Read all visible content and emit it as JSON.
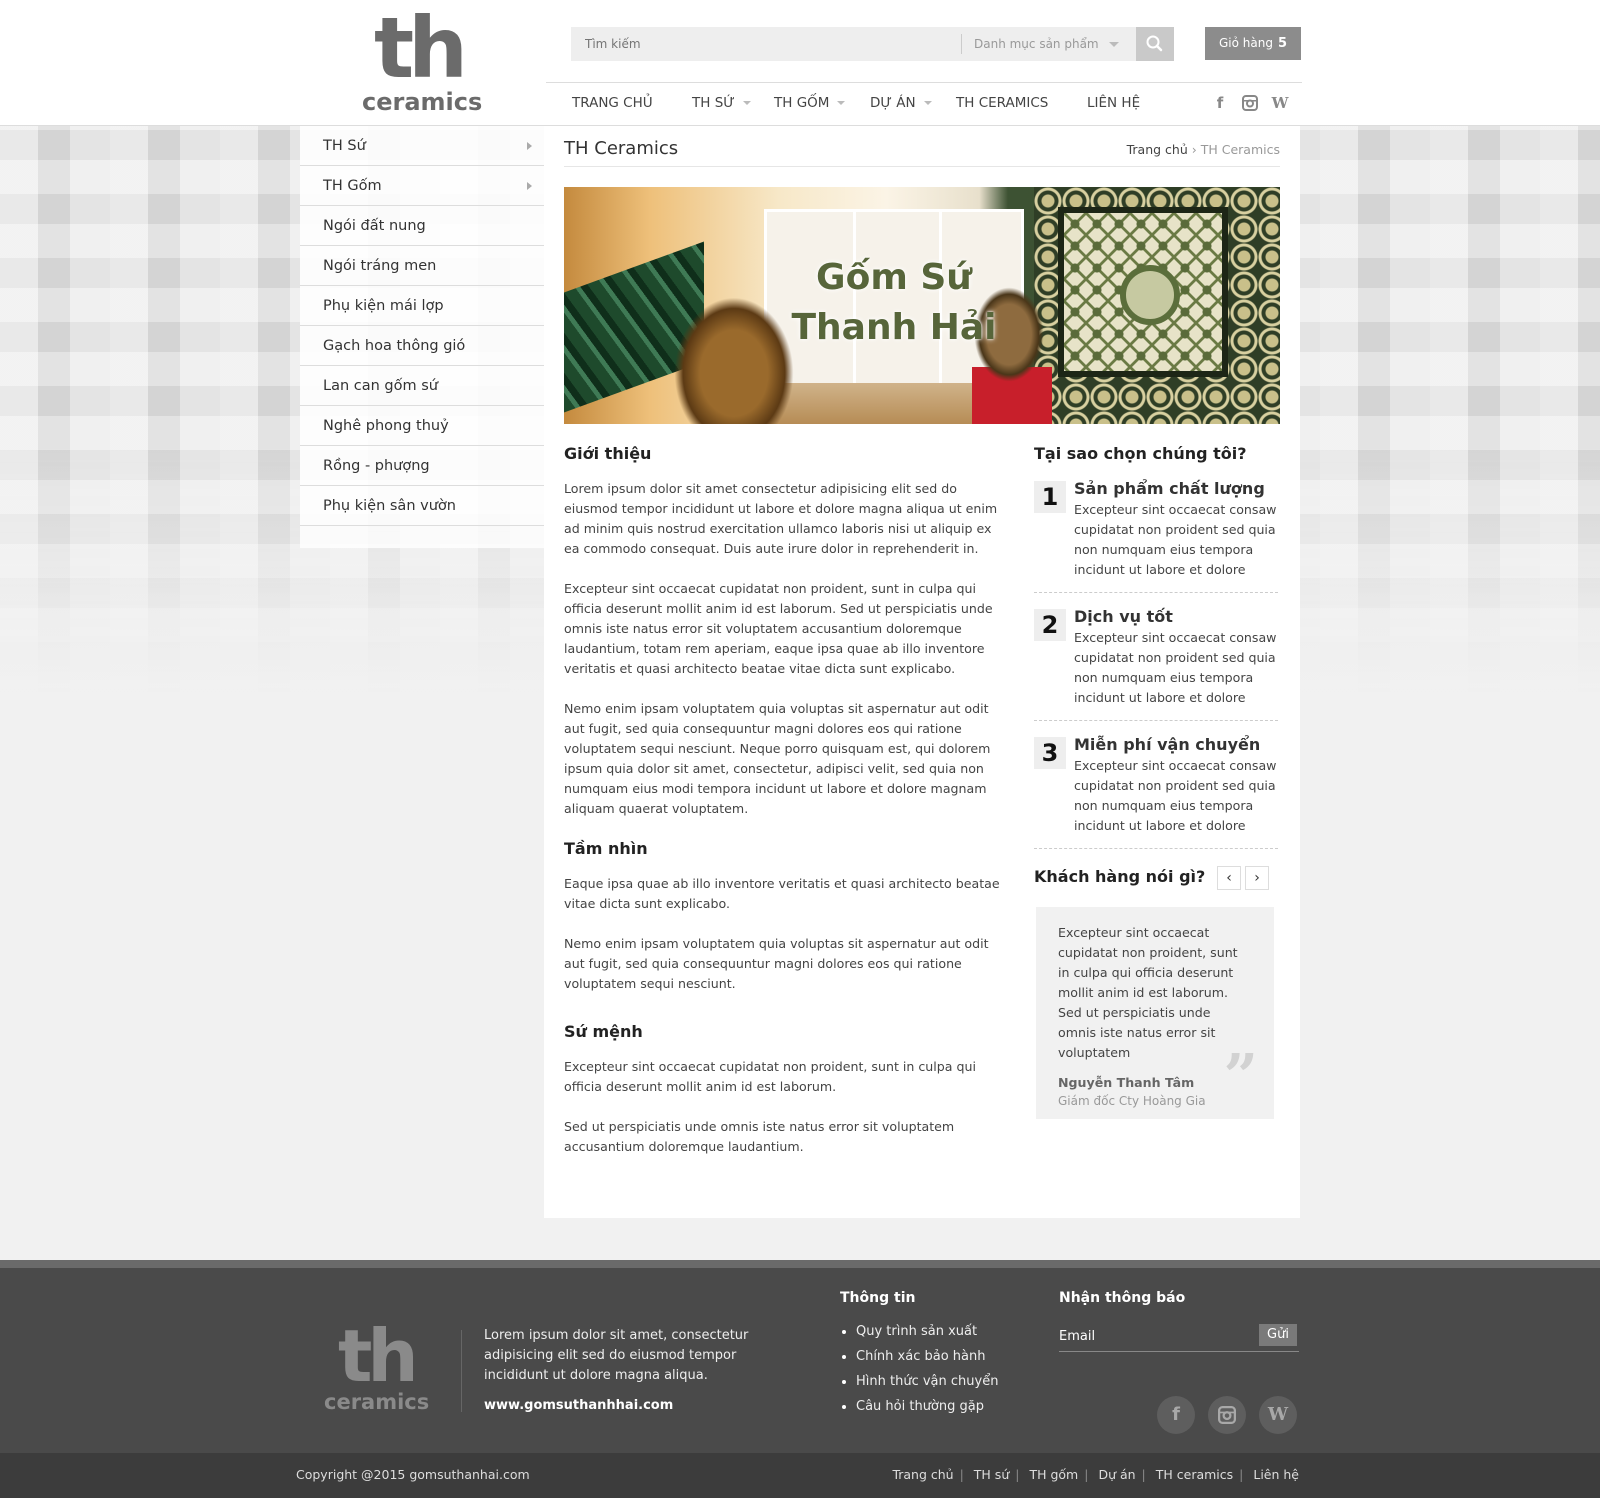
{
  "header": {
    "logo_main": "th",
    "logo_sub": "ceramics",
    "search_placeholder": "Tìm kiếm",
    "category_select": "Danh mục sản phẩm",
    "cart_label": "Giỏ hàng",
    "cart_count": "5"
  },
  "nav": {
    "items": [
      {
        "label": "TRANG CHỦ",
        "dropdown": false
      },
      {
        "label": "TH SỨ",
        "dropdown": true
      },
      {
        "label": "TH GỐM",
        "dropdown": true
      },
      {
        "label": "DỰ ÁN",
        "dropdown": true
      },
      {
        "label": "TH CERAMICS",
        "dropdown": false
      },
      {
        "label": "LIÊN HỆ",
        "dropdown": false
      }
    ],
    "social": [
      "facebook-icon",
      "instagram-icon",
      "wordpress-icon"
    ]
  },
  "sidebar": {
    "items": [
      {
        "label": "TH Sứ",
        "arrow": true
      },
      {
        "label": "TH Gốm",
        "arrow": true
      },
      {
        "label": "Ngói đất nung",
        "arrow": false
      },
      {
        "label": "Ngói tráng men",
        "arrow": false
      },
      {
        "label": "Phụ kiện mái lợp",
        "arrow": false
      },
      {
        "label": "Gạch hoa thông gió",
        "arrow": false
      },
      {
        "label": "Lan can gốm sứ",
        "arrow": false
      },
      {
        "label": "Nghê phong thuỷ",
        "arrow": false
      },
      {
        "label": "Rồng - phượng",
        "arrow": false
      },
      {
        "label": "Phụ kiện sân vườn",
        "arrow": false
      }
    ]
  },
  "page": {
    "title": "TH Ceramics",
    "breadcrumb": {
      "home": "Trang chủ",
      "sep": "›",
      "current": "TH Ceramics"
    },
    "banner": {
      "line1": "Gốm Sứ",
      "line2": "Thanh Hải"
    }
  },
  "content": {
    "intro_title": "Giới thiệu",
    "intro_p1": "Lorem ipsum dolor sit amet consectetur adipisicing elit sed do eiusmod tempor incididunt ut labore et dolore magna aliqua ut enim ad minim quis nostrud exercitation ullamco laboris nisi ut aliquip ex ea commodo consequat. Duis aute irure dolor in reprehenderit in.",
    "intro_p2": "Excepteur sint occaecat cupidatat non proident, sunt in culpa qui officia deserunt mollit anim id est laborum. Sed ut perspiciatis unde omnis iste natus error sit voluptatem accusantium doloremque laudantium, totam rem aperiam, eaque ipsa quae ab illo inventore veritatis et quasi architecto beatae vitae dicta sunt explicabo.",
    "intro_p3": "Nemo enim ipsam voluptatem quia voluptas sit aspernatur aut odit aut fugit, sed quia consequuntur magni dolores eos qui ratione voluptatem sequi nesciunt. Neque porro quisquam est, qui dolorem ipsum quia dolor sit amet, consectetur, adipisci velit, sed quia non numquam eius modi tempora incidunt ut labore et dolore magnam aliquam quaerat voluptatem.",
    "vision_title": "Tầm nhìn",
    "vision_p1": "Eaque ipsa quae ab illo inventore veritatis et quasi architecto beatae vitae dicta sunt explicabo.",
    "vision_p2": "Nemo enim ipsam voluptatem quia voluptas sit aspernatur aut odit aut fugit, sed quia consequuntur magni dolores eos qui ratione voluptatem sequi nesciunt.",
    "mission_title": "Sứ mệnh",
    "mission_p1": "Excepteur sint occaecat cupidatat non proident, sunt in culpa qui officia deserunt mollit anim id est laborum.",
    "mission_p2": "Sed ut perspiciatis unde omnis iste natus error sit voluptatem accusantium doloremque laudantium."
  },
  "why": {
    "title": "Tại sao chọn chúng tôi?",
    "items": [
      {
        "num": "1",
        "title": "Sản phẩm chất lượng",
        "desc": "Excepteur sint occaecat consaw cupidatat non proident  sed quia non numquam eius tempora incidunt ut labore et dolore"
      },
      {
        "num": "2",
        "title": "Dịch vụ tốt",
        "desc": "Excepteur sint occaecat consaw cupidatat non proident  sed quia non numquam eius tempora incidunt ut labore et dolore"
      },
      {
        "num": "3",
        "title": "Miễn phí vận chuyển",
        "desc": "Excepteur sint occaecat consaw cupidatat non proident  sed quia non numquam eius tempora incidunt ut labore et dolore"
      }
    ]
  },
  "testimonial": {
    "title": "Khách hàng nói gì?",
    "prev": "‹",
    "next": "›",
    "quote": "Excepteur sint occaecat cupidatat non proident, sunt in culpa qui officia deserunt mollit anim id est laborum. Sed ut perspiciatis unde omnis iste natus error sit voluptatem",
    "name": "Nguyễn Thanh Tâm",
    "role": "Giám đốc Cty Hoàng Gia"
  },
  "footer": {
    "logo_main": "th",
    "logo_sub": "ceramics",
    "about": "Lorem ipsum dolor sit amet, consectetur adipisicing elit sed do eiusmod tempor incididunt ut dolore magna aliqua.",
    "url": "www.gomsuthanhhai.com",
    "info_title": "Thông tin",
    "info_links": [
      "Quy trình sản xuất",
      "Chính xác bảo hành",
      "Hình thức vận chuyển",
      "Câu hỏi thường gặp"
    ],
    "news_title": "Nhận thông báo",
    "email_placeholder": "Email",
    "send_label": "Gửi",
    "social": [
      "facebook-icon",
      "instagram-icon",
      "wordpress-icon"
    ]
  },
  "bottom": {
    "copyright": "Copyright @2015 gomsuthanhai.com",
    "links": [
      "Trang chủ",
      "TH sứ",
      "TH gốm",
      "Dự án",
      "TH ceramics",
      "Liên hệ"
    ]
  }
}
